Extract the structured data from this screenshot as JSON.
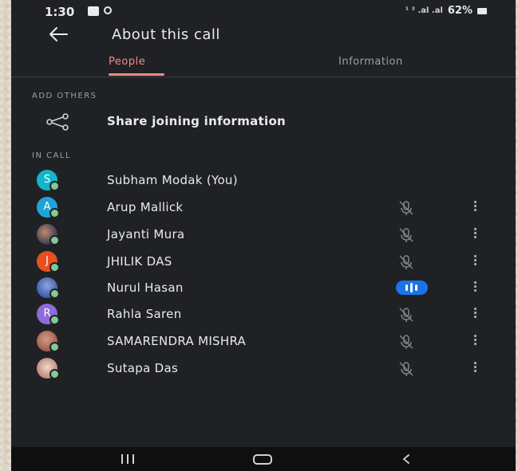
{
  "statusbar": {
    "time": "1:30",
    "network": "¹ ² .al .al",
    "battery": "62%"
  },
  "appbar": {
    "title": "About this call"
  },
  "tabs": [
    {
      "label": "People",
      "active": true
    },
    {
      "label": "Information",
      "active": false
    }
  ],
  "add_others": {
    "header": "ADD OTHERS",
    "share_label": "Share joining information"
  },
  "in_call": {
    "header": "IN CALL",
    "people": [
      {
        "name": "Subham Modak (You)",
        "initial": "S",
        "avatar_color": "#12b5cb",
        "state": "none"
      },
      {
        "name": "Arup Mallick",
        "initial": "A",
        "avatar_color": "#1fa3d8",
        "state": "muted"
      },
      {
        "name": "Jayanti Mura",
        "initial": "",
        "avatar_color": "#3b3a55",
        "state": "muted"
      },
      {
        "name": "JHILIK DAS",
        "initial": "J",
        "avatar_color": "#e8501f",
        "state": "muted"
      },
      {
        "name": "Nurul Hasan",
        "initial": "",
        "avatar_color": "#3f5ea8",
        "state": "speaking"
      },
      {
        "name": "Rahla Saren",
        "initial": "R",
        "avatar_color": "#8e6bd8",
        "state": "muted"
      },
      {
        "name": "SAMARENDRA MISHRA",
        "initial": "",
        "avatar_color": "#9b5c4a",
        "state": "muted"
      },
      {
        "name": "Sutapa Das",
        "initial": "",
        "avatar_color": "#b98a7a",
        "state": "muted"
      }
    ]
  },
  "colors": {
    "accent": "#f28b82",
    "background": "#202124",
    "speaking": "#1a73e8",
    "online": "#81c995"
  }
}
